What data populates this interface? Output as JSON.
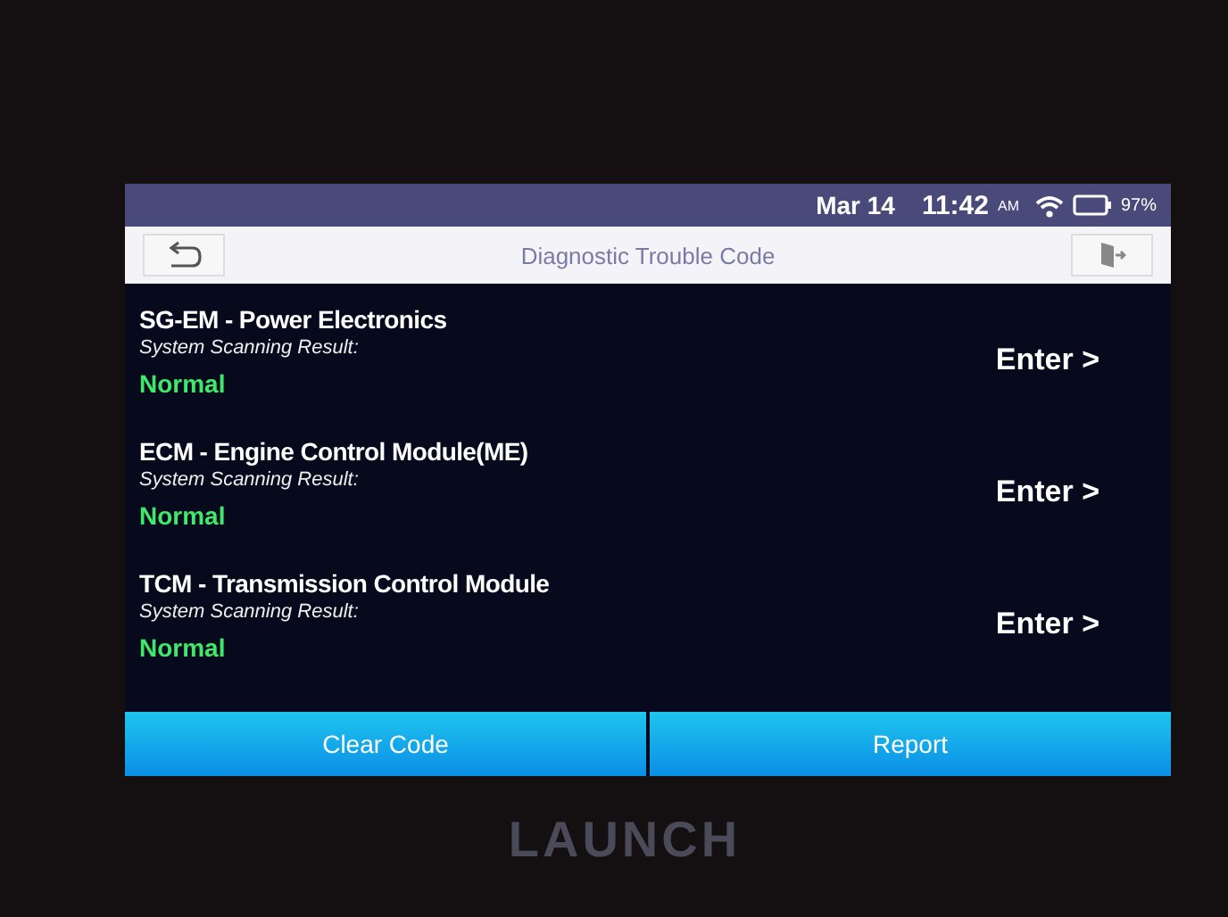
{
  "status_bar": {
    "date": "Mar 14",
    "time": "11:42",
    "ampm": "AM",
    "battery": "97%"
  },
  "title_bar": {
    "title": "Diagnostic Trouble Code"
  },
  "systems": [
    {
      "name": "SG-EM - Power Electronics",
      "result_label": "System Scanning Result:",
      "result": "Normal",
      "action": "Enter >"
    },
    {
      "name": "ECM - Engine Control Module(ME)",
      "result_label": "System Scanning Result:",
      "result": "Normal",
      "action": "Enter >"
    },
    {
      "name": "TCM - Transmission Control Module",
      "result_label": "System Scanning Result:",
      "result": "Normal",
      "action": "Enter >"
    }
  ],
  "buttons": [
    "Clear Code",
    "Report"
  ],
  "device": {
    "brand": "LAUNCH"
  }
}
